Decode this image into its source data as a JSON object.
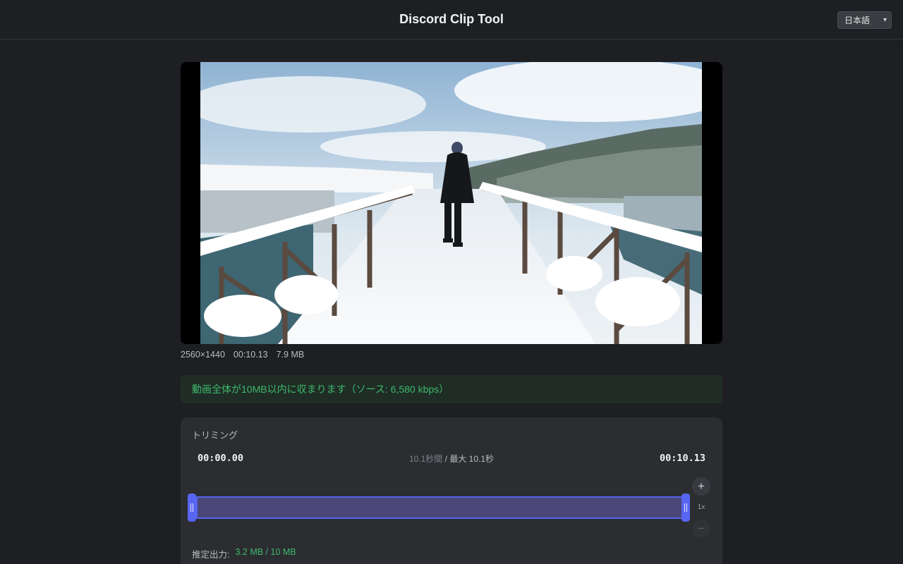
{
  "header": {
    "title": "Discord Clip Tool"
  },
  "language": {
    "selected": "日本語"
  },
  "video": {
    "resolution": "2560×1440",
    "duration": "00:10.13",
    "size": "7.9 MB"
  },
  "banner": {
    "text": "動画全体が10MB以内に収まります（ソース: 6,580 kbps）"
  },
  "trim": {
    "title": "トリミング",
    "start": "00:00.00",
    "end": "00:10.13",
    "selected_duration": "10.1秒間",
    "separator": " / ",
    "max_duration": "最大 10.1秒",
    "selection_start_fraction": 0.0,
    "selection_end_fraction": 1.0,
    "zoom_level": "1x",
    "zoom_in": "+",
    "zoom_out": "−"
  },
  "estimate": {
    "label": "推定出力:",
    "value": "3.2 MB / 10 MB"
  },
  "colors": {
    "accent": "#5865f2",
    "success": "#3fb86a",
    "background": "#1e1f22",
    "panel": "#2b2d31"
  }
}
